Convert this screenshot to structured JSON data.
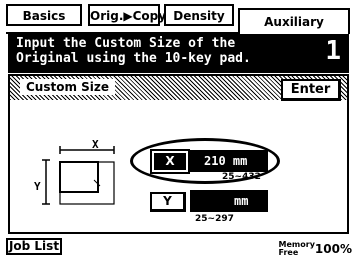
{
  "tabs": [
    {
      "label": "Basics"
    },
    {
      "label": "Orig.▶Copy"
    },
    {
      "label": "Density"
    },
    {
      "label": "Auxiliary"
    }
  ],
  "message": {
    "line1": "Input the Custom Size of the",
    "line2": "Original using the 10-key pad.",
    "step": "1"
  },
  "panel": {
    "title": "Custom Size",
    "enter_label": "Enter"
  },
  "x_field": {
    "button_label": "X",
    "value": "210 mm",
    "range": "25~432"
  },
  "y_field": {
    "button_label": "Y",
    "value": "mm",
    "range": "25~297"
  },
  "diagram": {
    "x_label": "X",
    "y_label": "Y"
  },
  "footer": {
    "job_list": "Job List",
    "memory_line1": "Memory",
    "memory_line2": "Free",
    "memory_percent": "100%"
  }
}
